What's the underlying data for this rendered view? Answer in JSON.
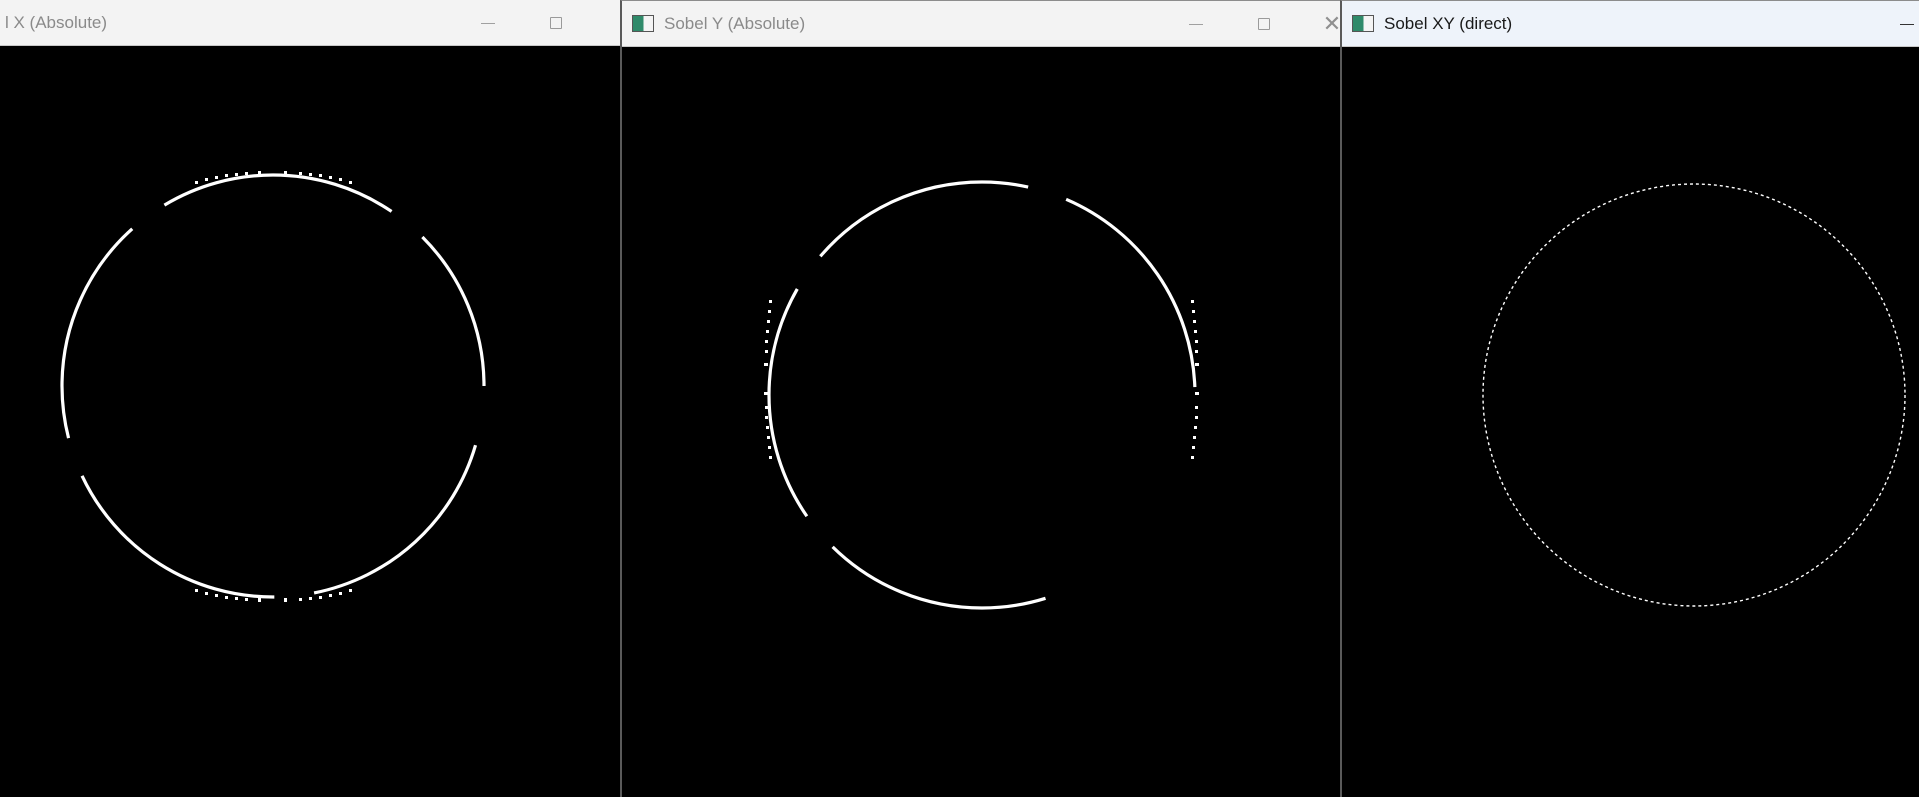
{
  "windows": [
    {
      "title": "l X (Absolute)",
      "icon": "opencv-window-icon",
      "buttons": [
        "minimize",
        "maximize"
      ],
      "image": "sobel-x-circle-edges"
    },
    {
      "title": "Sobel Y (Absolute)",
      "icon": "opencv-window-icon",
      "buttons": [
        "minimize",
        "maximize",
        "close"
      ],
      "image": "sobel-y-circle-edges"
    },
    {
      "title": "Sobel XY (direct)",
      "icon": "opencv-window-icon",
      "buttons": [
        "minimize"
      ],
      "image": "sobel-xy-circle-edges"
    }
  ],
  "colors": {
    "titlebar_inactive": "#f3f3f3",
    "titlebar_active": "#eef3fa",
    "canvas": "#000000",
    "edge": "#ffffff"
  }
}
